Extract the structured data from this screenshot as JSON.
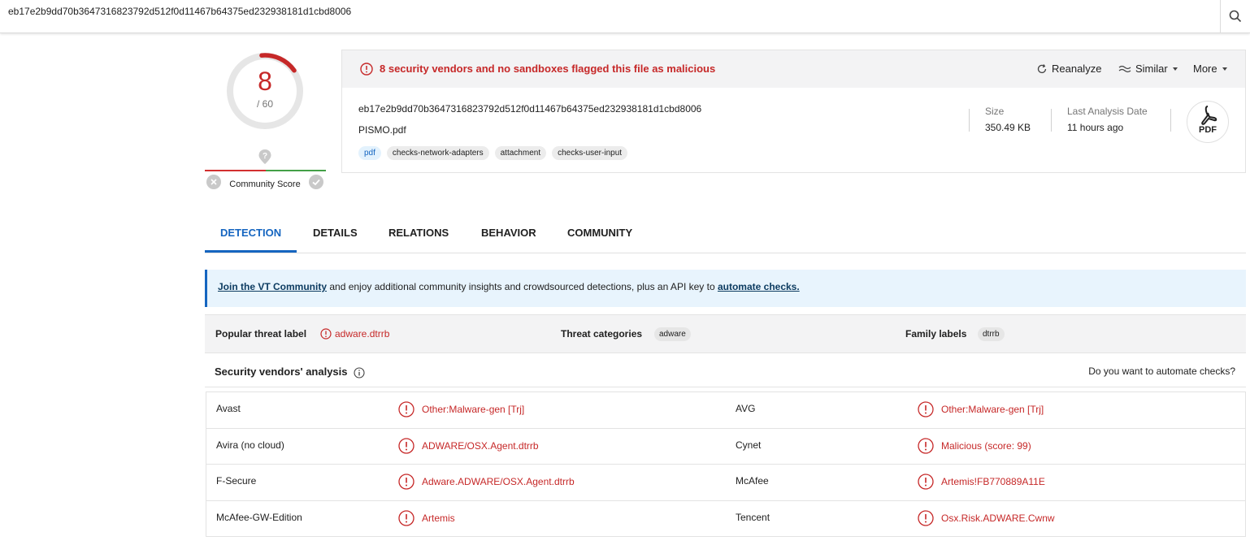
{
  "search": {
    "value": "eb17e2b9dd70b3647316823792d512f0d11467b64375ed232938181d1cbd8006"
  },
  "score": {
    "detections": "8",
    "total": "/ 60"
  },
  "community": {
    "label": "Community Score"
  },
  "summary": {
    "alert": "8 security vendors and no sandboxes flagged this file as malicious",
    "actions": {
      "reanalyze": "Reanalyze",
      "similar": "Similar",
      "more": "More"
    },
    "hash": "eb17e2b9dd70b3647316823792d512f0d11467b64375ed232938181d1cbd8006",
    "filename": "PISMO.pdf",
    "tags": [
      "pdf",
      "checks-network-adapters",
      "attachment",
      "checks-user-input"
    ],
    "size_label": "Size",
    "size_value": "350.49 KB",
    "date_label": "Last Analysis Date",
    "date_value": "11 hours ago",
    "filetype_icon": "PDF"
  },
  "tabs": [
    "DETECTION",
    "DETAILS",
    "RELATIONS",
    "BEHAVIOR",
    "COMMUNITY"
  ],
  "banner": {
    "link1": "Join the VT Community",
    "middle": " and enjoy additional community insights and crowdsourced detections, plus an API key to ",
    "link2": "automate checks."
  },
  "threat": {
    "popular_label": "Popular threat label",
    "popular_value": "adware.dtrrb",
    "categories_label": "Threat categories",
    "categories_value": "adware",
    "family_label": "Family labels",
    "family_value": "dtrrb"
  },
  "vendors": {
    "title": "Security vendors' analysis",
    "automate_question": "Do you want to automate checks?",
    "rows": [
      {
        "left_vendor": "Avast",
        "left_result": "Other:Malware-gen [Trj]",
        "right_vendor": "AVG",
        "right_result": "Other:Malware-gen [Trj]"
      },
      {
        "left_vendor": "Avira (no cloud)",
        "left_result": "ADWARE/OSX.Agent.dtrrb",
        "right_vendor": "Cynet",
        "right_result": "Malicious (score: 99)"
      },
      {
        "left_vendor": "F-Secure",
        "left_result": "Adware.ADWARE/OSX.Agent.dtrrb",
        "right_vendor": "McAfee",
        "right_result": "Artemis!FB770889A11E"
      },
      {
        "left_vendor": "McAfee-GW-Edition",
        "left_result": "Artemis",
        "right_vendor": "Tencent",
        "right_result": "Osx.Risk.ADWARE.Cwnw"
      }
    ]
  },
  "colors": {
    "malicious": "#c62828",
    "accent": "#1565c0",
    "safe": "#43a047"
  }
}
